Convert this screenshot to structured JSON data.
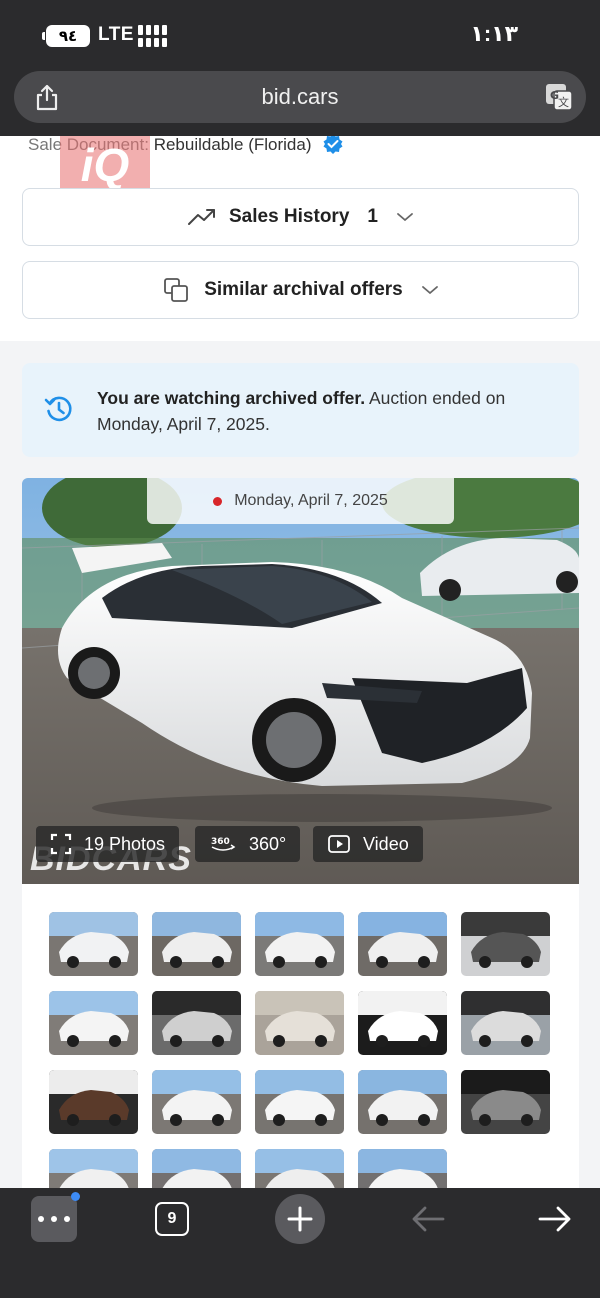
{
  "status_bar": {
    "battery": "٩٤",
    "network": "LTE",
    "time": "١:١٣"
  },
  "browser": {
    "url": "bid.cars",
    "tab_count": "9"
  },
  "listing": {
    "sale_document_label": "Sale Document:",
    "sale_document_value": "Rebuildable (Florida)",
    "logo_text": "iQ",
    "sales_history_label": "Sales History",
    "sales_history_count": "1",
    "similar_offers_label": "Similar archival offers",
    "notice_bold": "You are watching archived offer.",
    "notice_text": " Auction ended on Monday, April 7, 2025.",
    "photo_date": "Monday, April 7, 2025",
    "photos_label": "19 Photos",
    "view360_label": "360°",
    "video_label": "Video",
    "watermark": "BIDCARS"
  },
  "thumbnails": [
    {
      "scene": "front-34"
    },
    {
      "scene": "front-34-b"
    },
    {
      "scene": "rear-34"
    },
    {
      "scene": "rear-34-b"
    },
    {
      "scene": "interior"
    },
    {
      "scene": "rear"
    },
    {
      "scene": "gauges"
    },
    {
      "scene": "seats"
    },
    {
      "scene": "label"
    },
    {
      "scene": "engine"
    },
    {
      "scene": "key"
    },
    {
      "scene": "front"
    },
    {
      "scene": "side"
    },
    {
      "scene": "side-b"
    },
    {
      "scene": "cluster"
    },
    {
      "scene": "rear-c"
    },
    {
      "scene": "rear-d"
    },
    {
      "scene": "side-c"
    },
    {
      "scene": "front-c"
    }
  ],
  "colors": {
    "accent": "#3d8bf5",
    "notice_bg": "#e8f3fb",
    "dark_chrome": "#2b2b2d"
  }
}
